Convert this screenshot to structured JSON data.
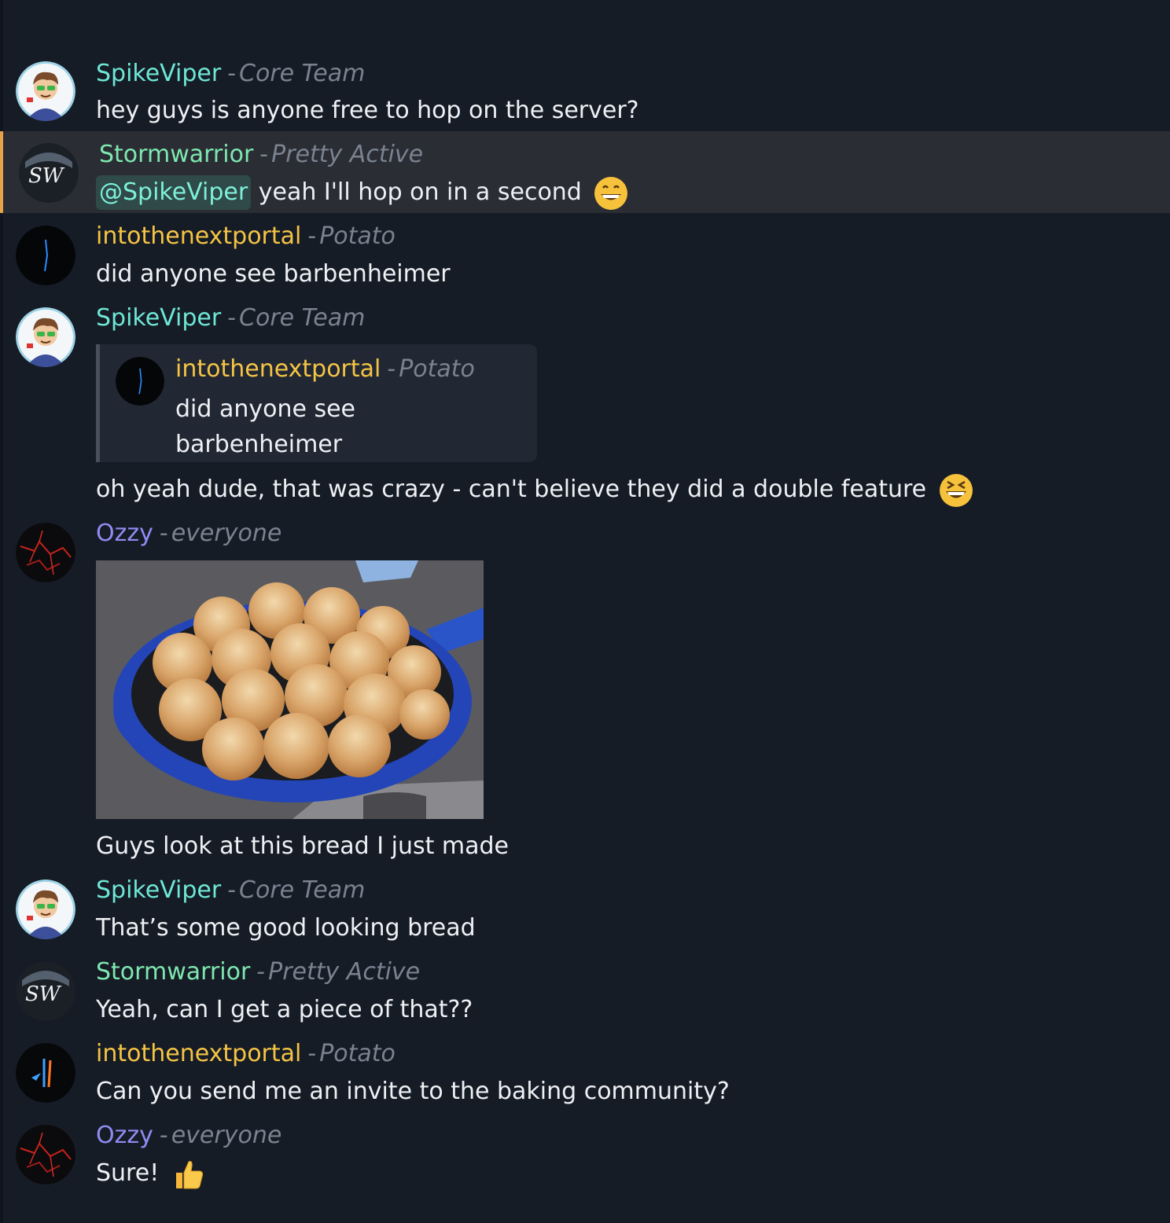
{
  "colors": {
    "background": "#161c26",
    "highlight_bg": "#2a2d33",
    "highlight_border": "#e8a24a",
    "teal": "#6ee7d6",
    "green": "#7ee8b0",
    "gold": "#f5c445",
    "purple": "#8f8cf2",
    "role_gray": "#7b8290"
  },
  "messages": [
    {
      "user": "SpikeViper",
      "role": "Core Team",
      "text": "hey guys is anyone free to hop on the server?",
      "avatar": "spikeviper-avatar"
    },
    {
      "user": "Stormwarrior",
      "role": "Pretty Active",
      "mention": "@SpikeViper",
      "text": " yeah I'll hop on in a second",
      "emoji": "grinning-emoji",
      "highlighted": true,
      "avatar": "stormwarrior-avatar"
    },
    {
      "user": "intothenextportal",
      "role": "Potato",
      "text": "did anyone see barbenheimer",
      "avatar": "portal-avatar"
    },
    {
      "user": "SpikeViper",
      "role": "Core Team",
      "reply": {
        "user": "intothenextportal",
        "role": "Potato",
        "text": "did anyone see barbenheimer"
      },
      "text": "oh yeah dude, that was crazy - can't believe they did a double feature",
      "emoji": "laughing-emoji",
      "avatar": "spikeviper-avatar"
    },
    {
      "user": "Ozzy",
      "role": "everyone",
      "image": "bread-rolls-photo",
      "text": "Guys look at this bread I just made",
      "avatar": "ozzy-avatar"
    },
    {
      "user": "SpikeViper",
      "role": "Core Team",
      "text": "That’s some good looking bread",
      "avatar": "spikeviper-avatar"
    },
    {
      "user": "Stormwarrior",
      "role": "Pretty Active",
      "text": "Yeah, can I get a piece of that??",
      "avatar": "stormwarrior-avatar"
    },
    {
      "user": "intothenextportal",
      "role": "Potato",
      "text": "Can you send me an invite to the baking community?",
      "avatar": "portal-avatar-2"
    },
    {
      "user": "Ozzy",
      "role": "everyone",
      "text": "Sure!",
      "emoji": "thumbs-up-emoji",
      "avatar": "ozzy-avatar"
    }
  ],
  "separator": "-"
}
